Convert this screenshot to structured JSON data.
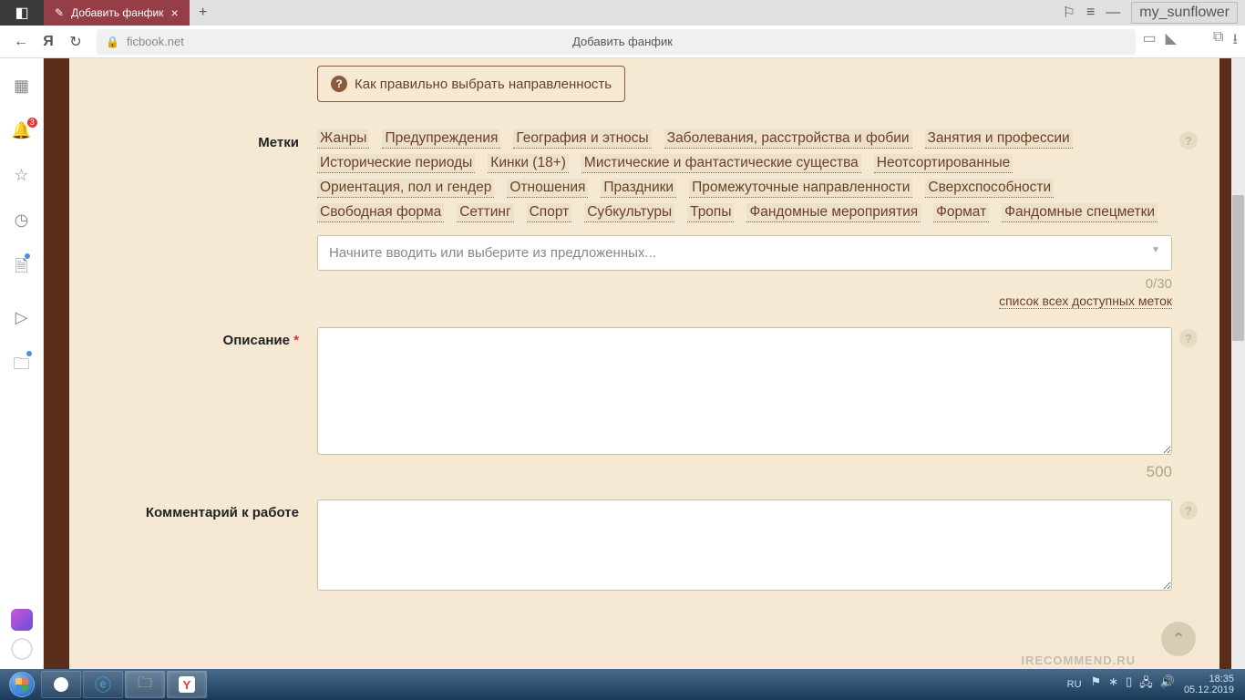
{
  "titlebar": {
    "tab_title": "Добавить фанфик",
    "user": "my_sunflower"
  },
  "address": {
    "url": "ficbook.net",
    "page_title": "Добавить фанфик"
  },
  "sidebar": {
    "bell_badge": "3"
  },
  "form": {
    "tip_text": "Как правильно выбрать направленность",
    "labels": {
      "tags": "Метки",
      "description": "Описание",
      "comment": "Комментарий к работе"
    },
    "tags": [
      "Жанры",
      "Предупреждения",
      "География и этносы",
      "Заболевания, расстройства и фобии",
      "Занятия и профессии",
      "Исторические периоды",
      "Кинки (18+)",
      "Мистические и фантастические существа",
      "Неотсортированные",
      "Ориентация, пол и гендер",
      "Отношения",
      "Праздники",
      "Промежуточные направленности",
      "Сверхспособности",
      "Свободная форма",
      "Сеттинг",
      "Спорт",
      "Субкультуры",
      "Тропы",
      "Фандомные мероприятия",
      "Формат",
      "Фандомные спецметки"
    ],
    "tag_input_placeholder": "Начните вводить или выберите из предложенных...",
    "tag_counter": "0/30",
    "tag_all_link": "список всех доступных меток",
    "desc_counter": "500"
  },
  "tray": {
    "lang": "RU",
    "time": "18:35",
    "date": "05.12.2019"
  },
  "watermark": "IRECOMMEND.RU"
}
